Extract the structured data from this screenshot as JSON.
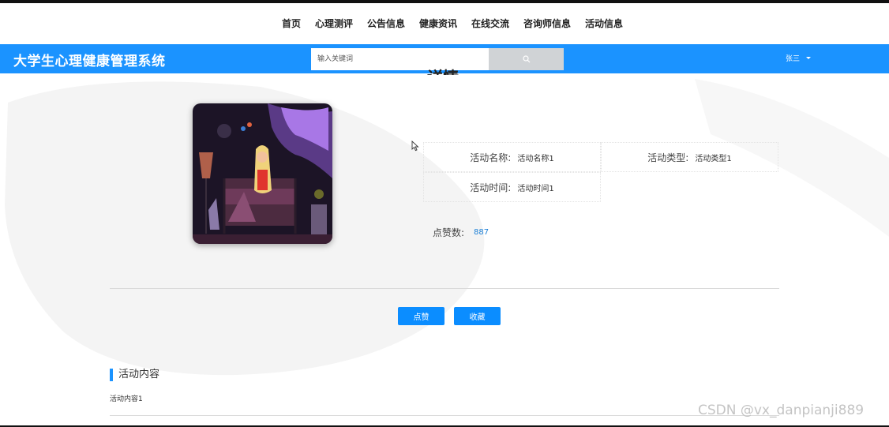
{
  "nav": {
    "items": [
      {
        "label": "首页"
      },
      {
        "label": "心理测评"
      },
      {
        "label": "公告信息"
      },
      {
        "label": "健康资讯"
      },
      {
        "label": "在线交流"
      },
      {
        "label": "咨询师信息"
      },
      {
        "label": "活动信息"
      }
    ]
  },
  "header": {
    "title": "大学生心理健康管理系统",
    "search_placeholder": "输入关键词",
    "user_name": "张三",
    "search_icon": "search-icon",
    "accent_color": "#1b93ff"
  },
  "detail": {
    "page_title": "详情",
    "fields": [
      {
        "label": "活动名称:",
        "value": "活动名称1"
      },
      {
        "label": "活动类型:",
        "value": "活动类型1"
      },
      {
        "label": "活动时间:",
        "value": "活动时间1"
      }
    ],
    "likes_label": "点赞数:",
    "likes_value": "887",
    "like_button": "点赞",
    "favorite_button": "收藏"
  },
  "content": {
    "section_title": "活动内容",
    "text": "活动内容1"
  },
  "watermark": "CSDN @vx_danpianji889"
}
